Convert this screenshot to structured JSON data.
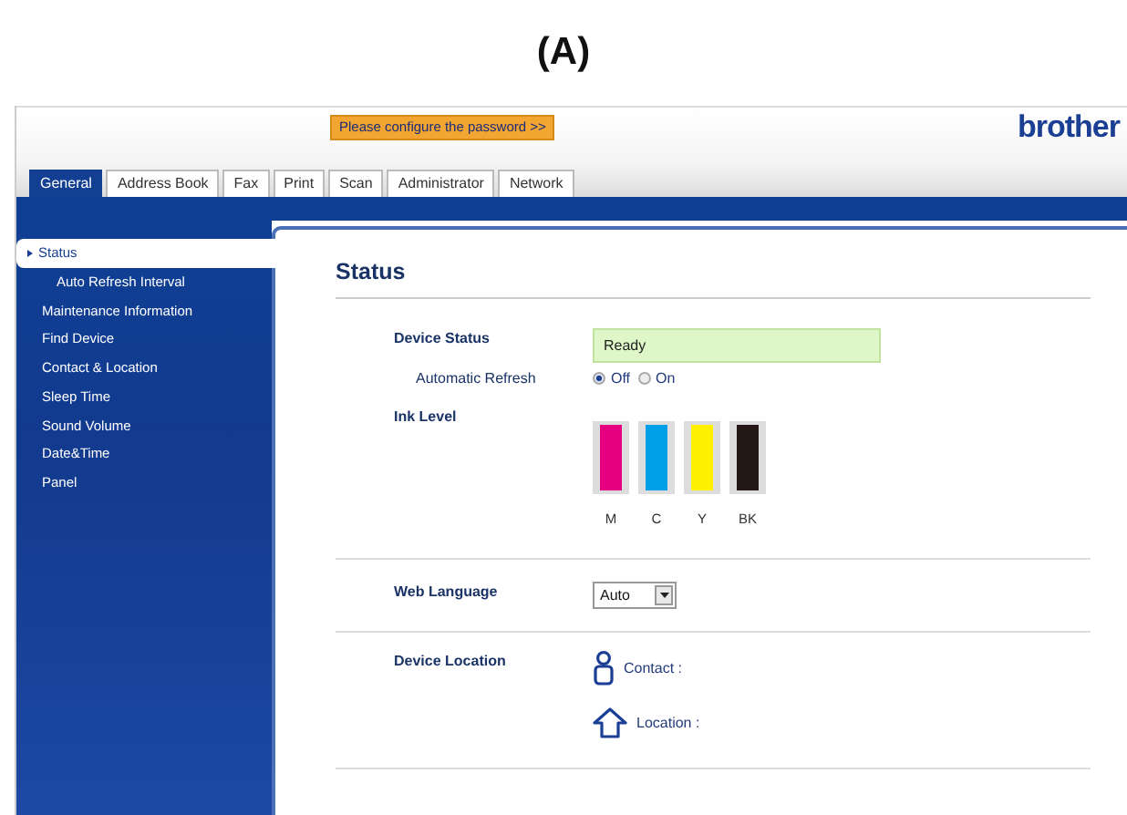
{
  "caption": "(A)",
  "header": {
    "password_button": "Please configure the password >>",
    "logo": "brother"
  },
  "tabs": [
    {
      "label": "General",
      "selected": true
    },
    {
      "label": "Address Book",
      "selected": false
    },
    {
      "label": "Fax",
      "selected": false
    },
    {
      "label": "Print",
      "selected": false
    },
    {
      "label": "Scan",
      "selected": false
    },
    {
      "label": "Administrator",
      "selected": false
    },
    {
      "label": "Network",
      "selected": false
    }
  ],
  "sidebar": {
    "items": [
      {
        "label": "Status",
        "selected": true,
        "children": [
          {
            "label": "Auto Refresh Interval",
            "selected": false
          }
        ]
      },
      {
        "label": "Maintenance Information",
        "selected": false
      },
      {
        "label": "Find Device",
        "selected": false
      },
      {
        "label": "Contact & Location",
        "selected": false
      },
      {
        "label": "Sleep Time",
        "selected": false
      },
      {
        "label": "Sound Volume",
        "selected": false
      },
      {
        "label": "Date&Time",
        "selected": false
      },
      {
        "label": "Panel",
        "selected": false
      }
    ]
  },
  "content": {
    "title": "Status",
    "device_status": {
      "label": "Device Status",
      "value": "Ready"
    },
    "automatic_refresh": {
      "label": "Automatic Refresh",
      "options": [
        {
          "label": "Off",
          "selected": true
        },
        {
          "label": "On",
          "selected": false
        }
      ]
    },
    "ink_level": {
      "label": "Ink Level",
      "inks": [
        {
          "name": "M",
          "color": "#e4007f",
          "level": 1
        },
        {
          "name": "C",
          "color": "#00a0e9",
          "level": 1
        },
        {
          "name": "Y",
          "color": "#fff100",
          "level": 1
        },
        {
          "name": "BK",
          "color": "#231815",
          "level": 1
        }
      ]
    },
    "web_language": {
      "label": "Web Language",
      "value": "Auto"
    },
    "device_location": {
      "label": "Device Location",
      "contact": "Contact :",
      "location": "Location :"
    }
  }
}
